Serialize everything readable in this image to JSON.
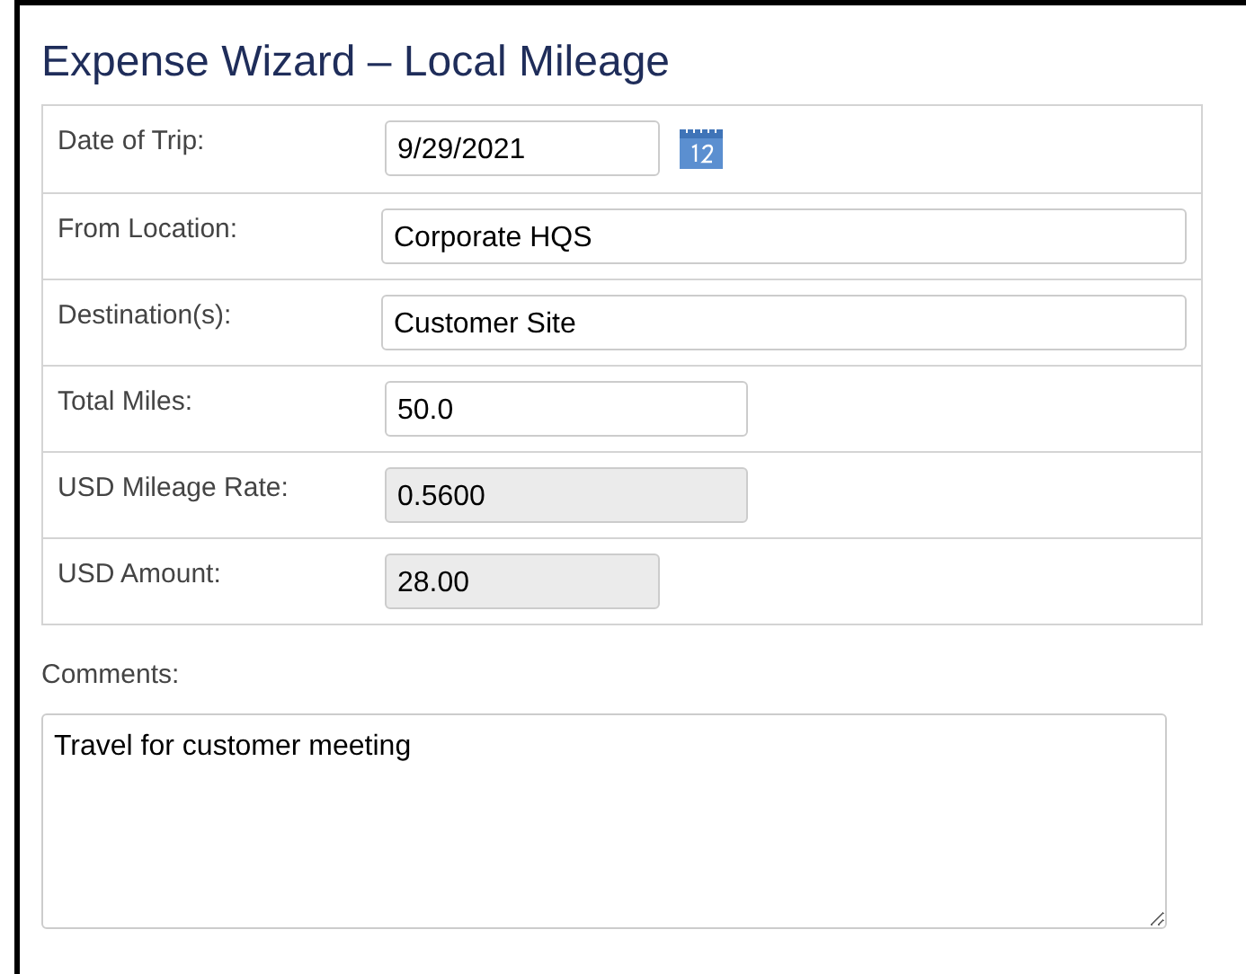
{
  "title": "Expense Wizard – Local Mileage",
  "fields": [
    {
      "label": "Date of Trip:",
      "kind": "date",
      "value": "9/29/2021",
      "disabled": false
    },
    {
      "label": "From Location:",
      "kind": "text",
      "value": "Corporate HQS",
      "disabled": false
    },
    {
      "label": "Destination(s):",
      "kind": "text",
      "value": "Customer Site",
      "disabled": false
    },
    {
      "label": "Total Miles:",
      "kind": "number",
      "value": "50.0",
      "disabled": false
    },
    {
      "label": "USD Mileage Rate:",
      "kind": "number",
      "value": "0.5600",
      "disabled": true
    },
    {
      "label": "USD Amount:",
      "kind": "amount",
      "value": "28.00",
      "disabled": true
    }
  ],
  "comments": {
    "label": "Comments:",
    "value": "Travel for customer meeting"
  }
}
